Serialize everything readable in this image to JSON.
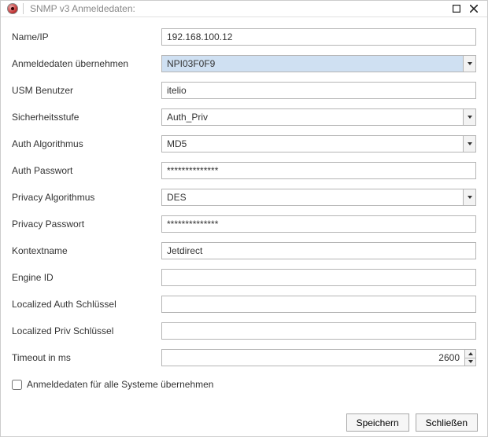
{
  "window": {
    "title": "SNMP v3 Anmeldedaten:"
  },
  "form": {
    "name_ip": {
      "label": "Name/IP",
      "value": "192.168.100.12"
    },
    "adopt_credentials": {
      "label": "Anmeldedaten übernehmen",
      "value": "NPI03F0F9"
    },
    "usm_user": {
      "label": "USM Benutzer",
      "value": "itelio"
    },
    "security_level": {
      "label": "Sicherheitsstufe",
      "value": "Auth_Priv"
    },
    "auth_algorithm": {
      "label": "Auth Algorithmus",
      "value": "MD5"
    },
    "auth_password": {
      "label": "Auth Passwort",
      "value": "**************"
    },
    "privacy_algorithm": {
      "label": "Privacy Algorithmus",
      "value": "DES"
    },
    "privacy_password": {
      "label": "Privacy Passwort",
      "value": "**************"
    },
    "context_name": {
      "label": "Kontextname",
      "value": "Jetdirect"
    },
    "engine_id": {
      "label": "Engine ID",
      "value": ""
    },
    "localized_auth_key": {
      "label": "Localized Auth Schlüssel",
      "value": ""
    },
    "localized_priv_key": {
      "label": "Localized Priv Schlüssel",
      "value": ""
    },
    "timeout": {
      "label": "Timeout in ms",
      "value": "2600"
    }
  },
  "checkbox": {
    "adopt_all": "Anmeldedaten für alle Systeme übernehmen"
  },
  "buttons": {
    "save": "Speichern",
    "close": "Schließen"
  }
}
